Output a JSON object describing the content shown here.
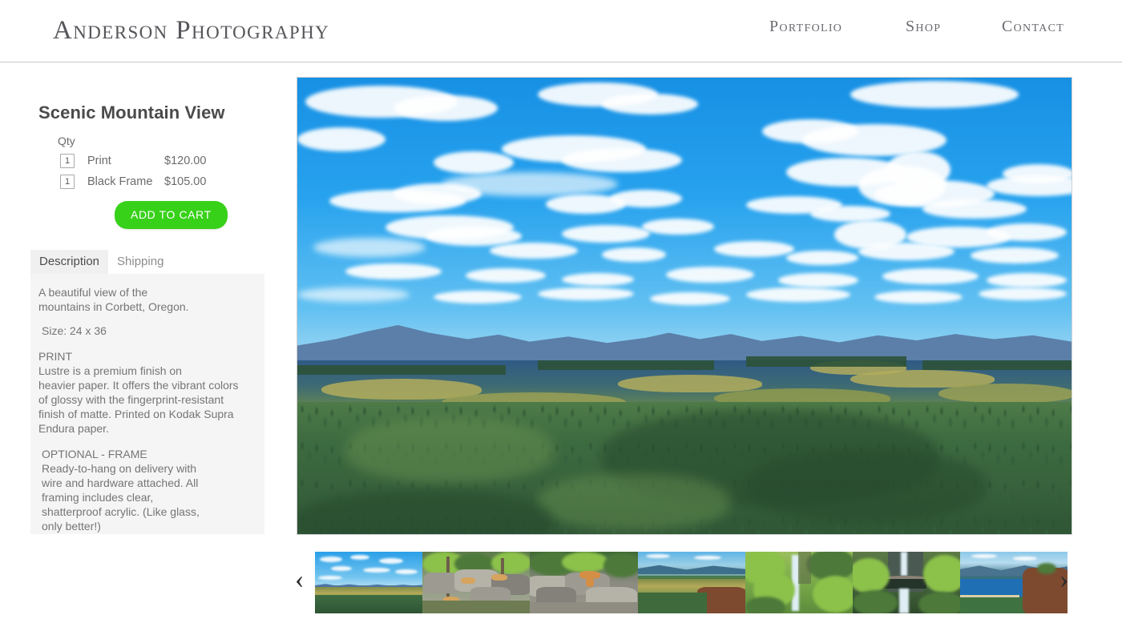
{
  "header": {
    "logo": "Anderson Photography",
    "nav": [
      {
        "label": "Portfolio"
      },
      {
        "label": "Shop"
      },
      {
        "label": "Contact"
      }
    ]
  },
  "product": {
    "title": "Scenic Mountain View",
    "qty_label": "Qty",
    "options": [
      {
        "qty": "1",
        "name": "Print",
        "price": "$120.00"
      },
      {
        "qty": "1",
        "name": "Black Frame",
        "price": "$105.00"
      }
    ],
    "add_to_cart_label": "ADD TO CART"
  },
  "tabs": [
    {
      "label": "Description",
      "active": true
    },
    {
      "label": "Shipping",
      "active": false
    }
  ],
  "description": {
    "intro": "A beautiful view of the\nmountains in Corbett, Oregon.",
    "size": "Size: 24 x 36",
    "print_heading": "PRINT",
    "print_body": "Lustre is a premium finish on\nheavier paper. It offers the vibrant colors\nof glossy with the fingerprint-resistant\nfinish of matte. Printed on Kodak Supra\nEndura paper.",
    "frame_heading": "OPTIONAL - FRAME",
    "frame_body": "Ready-to-hang on delivery with\nwire and hardware attached. All\nframing includes clear,\nshatterproof acrylic. (Like glass,\nonly better!)"
  },
  "gallery": {
    "hero_alt": "Scenic mountain view with blue sky, clouds, forested hills and golden fields",
    "prev_icon": "chevron-left-icon",
    "next_icon": "chevron-right-icon",
    "prev_glyph": "‹",
    "next_glyph": "›",
    "thumbnails": [
      {
        "alt": "Mountain valley panorama"
      },
      {
        "alt": "Lions resting on rocks"
      },
      {
        "alt": "Tiger walking on rocks"
      },
      {
        "alt": "River gorge with green hills"
      },
      {
        "alt": "Waterfall framed by bright foliage"
      },
      {
        "alt": "Multnomah Falls bridge"
      },
      {
        "alt": "Columbia River gorge vista"
      }
    ]
  },
  "colors": {
    "accent_green": "#37d119",
    "text_gray": "#757575",
    "title_gray": "#4a4a4a",
    "panel_bg": "#f5f5f5",
    "tab_active_bg": "#f0f0f0",
    "header_border": "#c8c8c8",
    "sky_blue": "#1e9be8"
  }
}
